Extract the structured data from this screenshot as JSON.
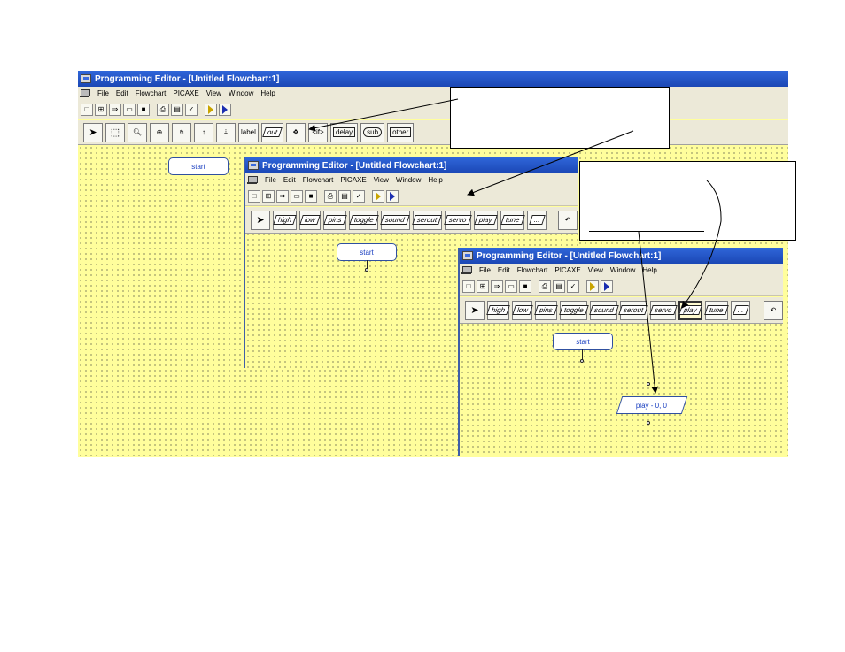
{
  "app_title": "Programming Editor  - [Untitled Flowchart:1]",
  "menu": [
    "File",
    "Edit",
    "Flowchart",
    "PICAXE",
    "View",
    "Window",
    "Help"
  ],
  "toolbar_icons": [
    "new-icon",
    "flowchart-icon",
    "convert-icon",
    "open-icon",
    "save-icon",
    "print-icon",
    "print-setup-icon",
    "spell-check-icon",
    "run-icon",
    "program-icon"
  ],
  "palette_main": {
    "tools": [
      "select-arrow-icon",
      "select-box-icon",
      "zoom-icon",
      "zoom-fit-icon",
      "pan-icon",
      "line-icon",
      "connector-icon"
    ],
    "label": "label",
    "out": "out",
    "if": "if",
    "delay": "delay",
    "sub": "sub",
    "other": "other"
  },
  "palette_out": {
    "commands": [
      "high",
      "low",
      "pins",
      "toggle",
      "sound",
      "serout",
      "servo",
      "play",
      "tune",
      "..."
    ],
    "back_icon": "undo-arrow-icon"
  },
  "canvas": {
    "start_label": "start",
    "play_label": "play - 0, 0"
  },
  "colors": {
    "titlebar": "#2f66d9",
    "canvas": "#fffe9c",
    "chrome": "#ece9d8",
    "arrow": "#000000"
  }
}
